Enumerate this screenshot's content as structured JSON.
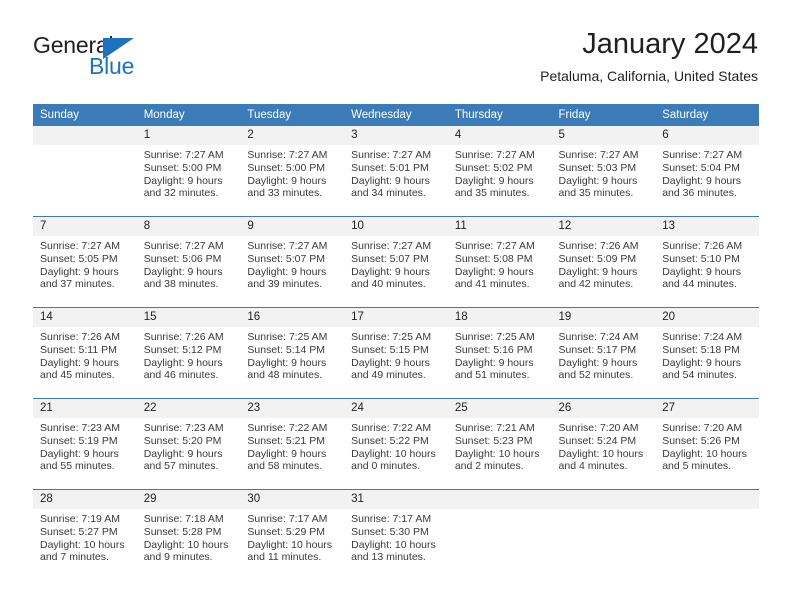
{
  "brand": {
    "name_part1": "General",
    "name_part2": "Blue",
    "flag_icon": "blue-triangle-flag",
    "accent_color": "#1e73be"
  },
  "header": {
    "title": "January 2024",
    "subtitle": "Petaluma, California, United States"
  },
  "theme": {
    "header_blue": "#3b7cb8",
    "daynum_band": "#f2f2f2",
    "text": "#231f20"
  },
  "calendar": {
    "weekday_headers": [
      "Sunday",
      "Monday",
      "Tuesday",
      "Wednesday",
      "Thursday",
      "Friday",
      "Saturday"
    ],
    "weeks": [
      [
        {
          "day": "",
          "blank": true
        },
        {
          "day": "1",
          "sunrise": "Sunrise: 7:27 AM",
          "sunset": "Sunset: 5:00 PM",
          "daylight_l1": "Daylight: 9 hours",
          "daylight_l2": "and 32 minutes."
        },
        {
          "day": "2",
          "sunrise": "Sunrise: 7:27 AM",
          "sunset": "Sunset: 5:00 PM",
          "daylight_l1": "Daylight: 9 hours",
          "daylight_l2": "and 33 minutes."
        },
        {
          "day": "3",
          "sunrise": "Sunrise: 7:27 AM",
          "sunset": "Sunset: 5:01 PM",
          "daylight_l1": "Daylight: 9 hours",
          "daylight_l2": "and 34 minutes."
        },
        {
          "day": "4",
          "sunrise": "Sunrise: 7:27 AM",
          "sunset": "Sunset: 5:02 PM",
          "daylight_l1": "Daylight: 9 hours",
          "daylight_l2": "and 35 minutes."
        },
        {
          "day": "5",
          "sunrise": "Sunrise: 7:27 AM",
          "sunset": "Sunset: 5:03 PM",
          "daylight_l1": "Daylight: 9 hours",
          "daylight_l2": "and 35 minutes."
        },
        {
          "day": "6",
          "sunrise": "Sunrise: 7:27 AM",
          "sunset": "Sunset: 5:04 PM",
          "daylight_l1": "Daylight: 9 hours",
          "daylight_l2": "and 36 minutes."
        }
      ],
      [
        {
          "day": "7",
          "sunrise": "Sunrise: 7:27 AM",
          "sunset": "Sunset: 5:05 PM",
          "daylight_l1": "Daylight: 9 hours",
          "daylight_l2": "and 37 minutes."
        },
        {
          "day": "8",
          "sunrise": "Sunrise: 7:27 AM",
          "sunset": "Sunset: 5:06 PM",
          "daylight_l1": "Daylight: 9 hours",
          "daylight_l2": "and 38 minutes."
        },
        {
          "day": "9",
          "sunrise": "Sunrise: 7:27 AM",
          "sunset": "Sunset: 5:07 PM",
          "daylight_l1": "Daylight: 9 hours",
          "daylight_l2": "and 39 minutes."
        },
        {
          "day": "10",
          "sunrise": "Sunrise: 7:27 AM",
          "sunset": "Sunset: 5:07 PM",
          "daylight_l1": "Daylight: 9 hours",
          "daylight_l2": "and 40 minutes."
        },
        {
          "day": "11",
          "sunrise": "Sunrise: 7:27 AM",
          "sunset": "Sunset: 5:08 PM",
          "daylight_l1": "Daylight: 9 hours",
          "daylight_l2": "and 41 minutes."
        },
        {
          "day": "12",
          "sunrise": "Sunrise: 7:26 AM",
          "sunset": "Sunset: 5:09 PM",
          "daylight_l1": "Daylight: 9 hours",
          "daylight_l2": "and 42 minutes."
        },
        {
          "day": "13",
          "sunrise": "Sunrise: 7:26 AM",
          "sunset": "Sunset: 5:10 PM",
          "daylight_l1": "Daylight: 9 hours",
          "daylight_l2": "and 44 minutes."
        }
      ],
      [
        {
          "day": "14",
          "sunrise": "Sunrise: 7:26 AM",
          "sunset": "Sunset: 5:11 PM",
          "daylight_l1": "Daylight: 9 hours",
          "daylight_l2": "and 45 minutes."
        },
        {
          "day": "15",
          "sunrise": "Sunrise: 7:26 AM",
          "sunset": "Sunset: 5:12 PM",
          "daylight_l1": "Daylight: 9 hours",
          "daylight_l2": "and 46 minutes."
        },
        {
          "day": "16",
          "sunrise": "Sunrise: 7:25 AM",
          "sunset": "Sunset: 5:14 PM",
          "daylight_l1": "Daylight: 9 hours",
          "daylight_l2": "and 48 minutes."
        },
        {
          "day": "17",
          "sunrise": "Sunrise: 7:25 AM",
          "sunset": "Sunset: 5:15 PM",
          "daylight_l1": "Daylight: 9 hours",
          "daylight_l2": "and 49 minutes."
        },
        {
          "day": "18",
          "sunrise": "Sunrise: 7:25 AM",
          "sunset": "Sunset: 5:16 PM",
          "daylight_l1": "Daylight: 9 hours",
          "daylight_l2": "and 51 minutes."
        },
        {
          "day": "19",
          "sunrise": "Sunrise: 7:24 AM",
          "sunset": "Sunset: 5:17 PM",
          "daylight_l1": "Daylight: 9 hours",
          "daylight_l2": "and 52 minutes."
        },
        {
          "day": "20",
          "sunrise": "Sunrise: 7:24 AM",
          "sunset": "Sunset: 5:18 PM",
          "daylight_l1": "Daylight: 9 hours",
          "daylight_l2": "and 54 minutes."
        }
      ],
      [
        {
          "day": "21",
          "sunrise": "Sunrise: 7:23 AM",
          "sunset": "Sunset: 5:19 PM",
          "daylight_l1": "Daylight: 9 hours",
          "daylight_l2": "and 55 minutes."
        },
        {
          "day": "22",
          "sunrise": "Sunrise: 7:23 AM",
          "sunset": "Sunset: 5:20 PM",
          "daylight_l1": "Daylight: 9 hours",
          "daylight_l2": "and 57 minutes."
        },
        {
          "day": "23",
          "sunrise": "Sunrise: 7:22 AM",
          "sunset": "Sunset: 5:21 PM",
          "daylight_l1": "Daylight: 9 hours",
          "daylight_l2": "and 58 minutes."
        },
        {
          "day": "24",
          "sunrise": "Sunrise: 7:22 AM",
          "sunset": "Sunset: 5:22 PM",
          "daylight_l1": "Daylight: 10 hours",
          "daylight_l2": "and 0 minutes."
        },
        {
          "day": "25",
          "sunrise": "Sunrise: 7:21 AM",
          "sunset": "Sunset: 5:23 PM",
          "daylight_l1": "Daylight: 10 hours",
          "daylight_l2": "and 2 minutes."
        },
        {
          "day": "26",
          "sunrise": "Sunrise: 7:20 AM",
          "sunset": "Sunset: 5:24 PM",
          "daylight_l1": "Daylight: 10 hours",
          "daylight_l2": "and 4 minutes."
        },
        {
          "day": "27",
          "sunrise": "Sunrise: 7:20 AM",
          "sunset": "Sunset: 5:26 PM",
          "daylight_l1": "Daylight: 10 hours",
          "daylight_l2": "and 5 minutes."
        }
      ],
      [
        {
          "day": "28",
          "sunrise": "Sunrise: 7:19 AM",
          "sunset": "Sunset: 5:27 PM",
          "daylight_l1": "Daylight: 10 hours",
          "daylight_l2": "and 7 minutes."
        },
        {
          "day": "29",
          "sunrise": "Sunrise: 7:18 AM",
          "sunset": "Sunset: 5:28 PM",
          "daylight_l1": "Daylight: 10 hours",
          "daylight_l2": "and 9 minutes."
        },
        {
          "day": "30",
          "sunrise": "Sunrise: 7:17 AM",
          "sunset": "Sunset: 5:29 PM",
          "daylight_l1": "Daylight: 10 hours",
          "daylight_l2": "and 11 minutes."
        },
        {
          "day": "31",
          "sunrise": "Sunrise: 7:17 AM",
          "sunset": "Sunset: 5:30 PM",
          "daylight_l1": "Daylight: 10 hours",
          "daylight_l2": "and 13 minutes."
        },
        {
          "day": "",
          "blank": true
        },
        {
          "day": "",
          "blank": true
        },
        {
          "day": "",
          "blank": true
        }
      ]
    ]
  }
}
